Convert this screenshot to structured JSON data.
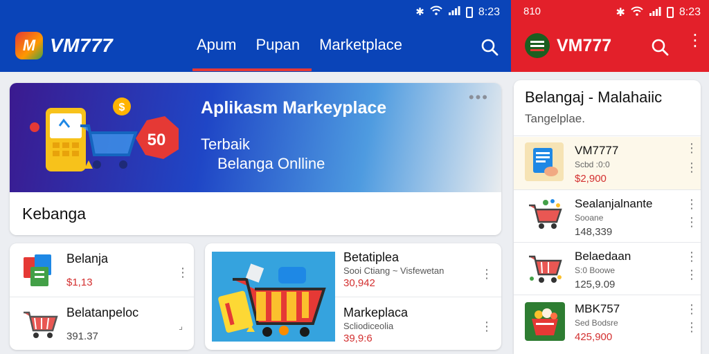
{
  "left": {
    "status": {
      "time": "8:23"
    },
    "brand": {
      "logo": "M",
      "name": "VM777"
    },
    "tabs": [
      {
        "label": "Apum"
      },
      {
        "label": "Pupan"
      },
      {
        "label": "Marketplace"
      }
    ],
    "banner": {
      "title": "Aplikasm Markeyplace",
      "sub1": "Terbaik",
      "sub2": "Belanga Onlline",
      "badge": "50",
      "footer": "Kebanga"
    },
    "card_a": [
      {
        "name": "Belanja",
        "price": "$1,13"
      },
      {
        "name": "Belatanpeloc",
        "price": "391.37"
      }
    ],
    "card_b": [
      {
        "name": "Betatiplea",
        "sub": "Sooi Ctiang ~ Visfewetan",
        "price": "30,942"
      },
      {
        "name": "Markeplaca",
        "sub": "Scliodiceolia",
        "price": "39,9:6"
      }
    ]
  },
  "right": {
    "status": {
      "left": "810",
      "time": "8:23"
    },
    "brand": {
      "name": "VM777"
    },
    "panel": {
      "title": "Belangaj - Malahaiic",
      "subtitle": "Tangelplae."
    },
    "items": [
      {
        "name": "VM7777",
        "sub": "Scbd :0:0",
        "price": "$2,900"
      },
      {
        "name": "Sealanjalnante",
        "sub": "Sooane",
        "price": "148,339"
      },
      {
        "name": "Belaedaan",
        "sub": "S:0 Boowe",
        "price": "125,9.09"
      },
      {
        "name": "MBK757",
        "sub": "Sed Bodsre",
        "price": "425,900"
      }
    ]
  },
  "colors": {
    "left_bar": "#0a44b8",
    "right_bar": "#e3202a",
    "accent_red": "#e53935",
    "price_red": "#d32f2f"
  }
}
